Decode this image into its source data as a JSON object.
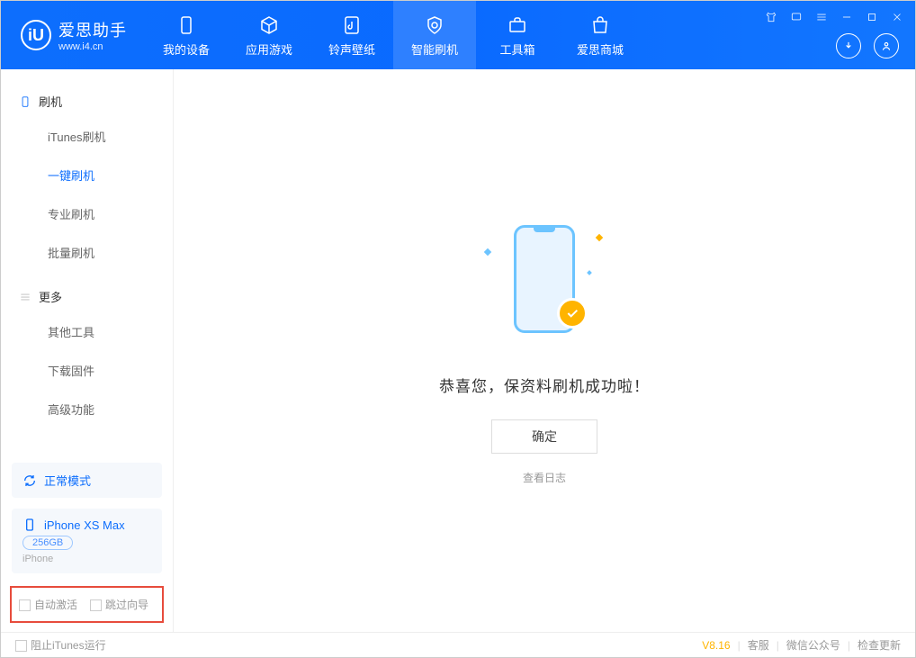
{
  "app": {
    "name_ch": "爱思助手",
    "url": "www.i4.cn"
  },
  "tabs": {
    "device": "我的设备",
    "apps": "应用游戏",
    "ring": "铃声壁纸",
    "flash": "智能刷机",
    "tools": "工具箱",
    "store": "爱思商城"
  },
  "sidebar": {
    "group1": "刷机",
    "itunes": "iTunes刷机",
    "oneclick": "一键刷机",
    "pro": "专业刷机",
    "batch": "批量刷机",
    "group2": "更多",
    "other": "其他工具",
    "firmware": "下载固件",
    "advanced": "高级功能"
  },
  "mode": "正常模式",
  "device": {
    "name": "iPhone XS Max",
    "storage": "256GB",
    "type": "iPhone"
  },
  "options": {
    "auto_activate": "自动激活",
    "skip_wizard": "跳过向导"
  },
  "main": {
    "success": "恭喜您，保资料刷机成功啦！",
    "ok": "确定",
    "view_log": "查看日志"
  },
  "status": {
    "block_itunes": "阻止iTunes运行",
    "version": "V8.16",
    "support": "客服",
    "wechat": "微信公众号",
    "update": "检查更新"
  }
}
